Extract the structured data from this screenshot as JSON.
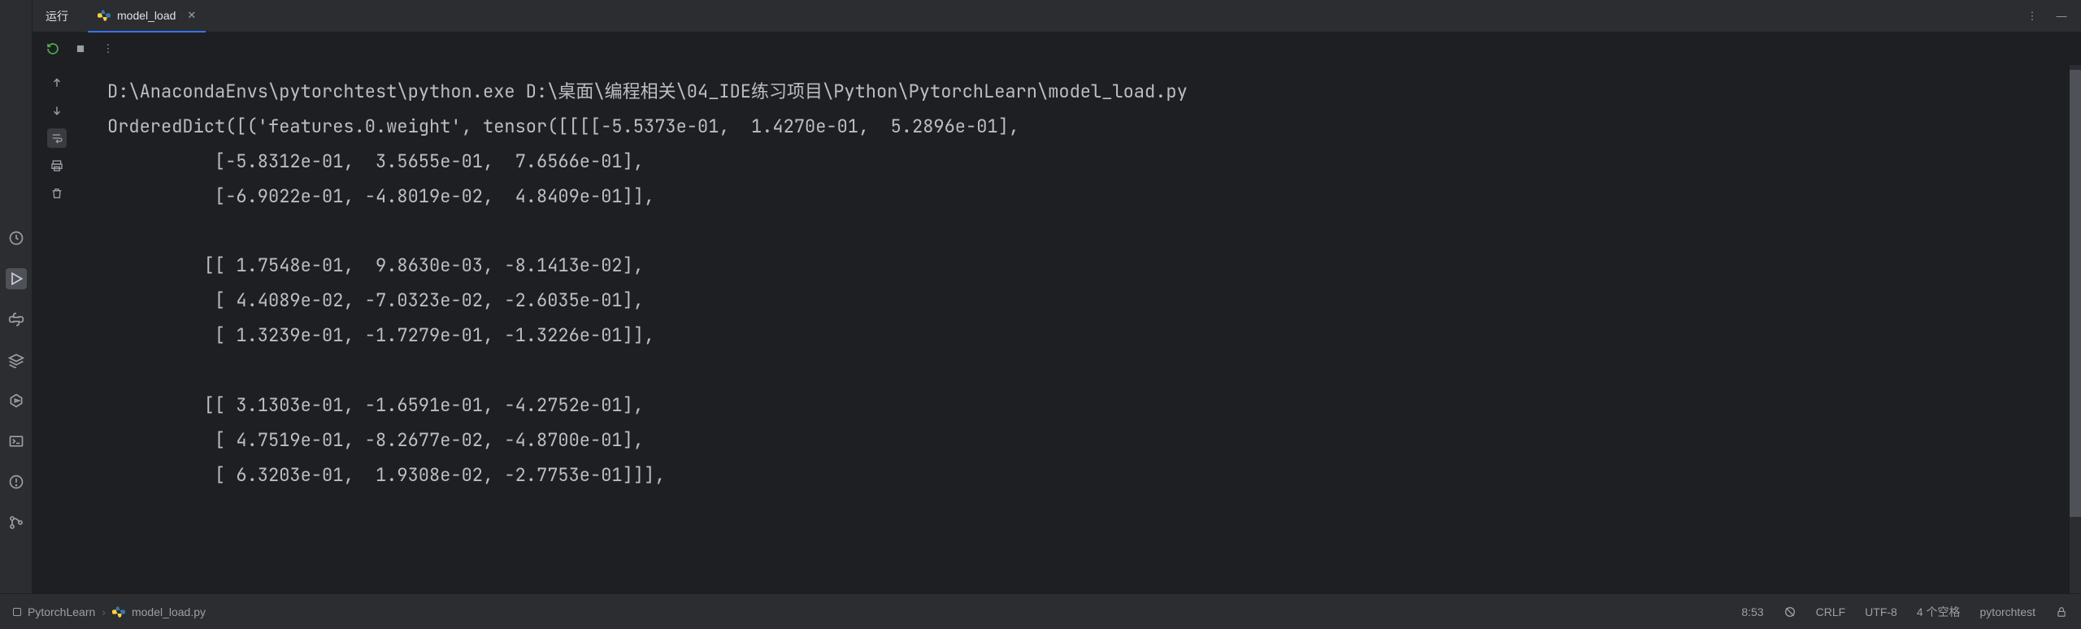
{
  "header": {
    "run_label": "运行",
    "tab": {
      "label": "model_load",
      "icon": "python-file-icon"
    }
  },
  "console": {
    "lines": [
      "D:\\AnacondaEnvs\\pytorchtest\\python.exe D:\\桌面\\编程相关\\04_IDE练习项目\\Python\\PytorchLearn\\model_load.py",
      "OrderedDict([('features.0.weight', tensor([[[[-5.5373e-01,  1.4270e-01,  5.2896e-01],",
      "          [-5.8312e-01,  3.5655e-01,  7.6566e-01],",
      "          [-6.9022e-01, -4.8019e-02,  4.8409e-01]],",
      "",
      "         [[ 1.7548e-01,  9.8630e-03, -8.1413e-02],",
      "          [ 4.4089e-02, -7.0323e-02, -2.6035e-01],",
      "          [ 1.3239e-01, -1.7279e-01, -1.3226e-01]],",
      "",
      "         [[ 3.1303e-01, -1.6591e-01, -4.2752e-01],",
      "          [ 4.7519e-01, -8.2677e-02, -4.8700e-01],",
      "          [ 6.3203e-01,  1.9308e-02, -2.7753e-01]]],"
    ]
  },
  "breadcrumb": {
    "project": "PytorchLearn",
    "file": "model_load.py"
  },
  "status": {
    "cursor": "8:53",
    "line_sep": "CRLF",
    "encoding": "UTF-8",
    "indent": "4 个空格",
    "interpreter": "pytorchtest"
  }
}
